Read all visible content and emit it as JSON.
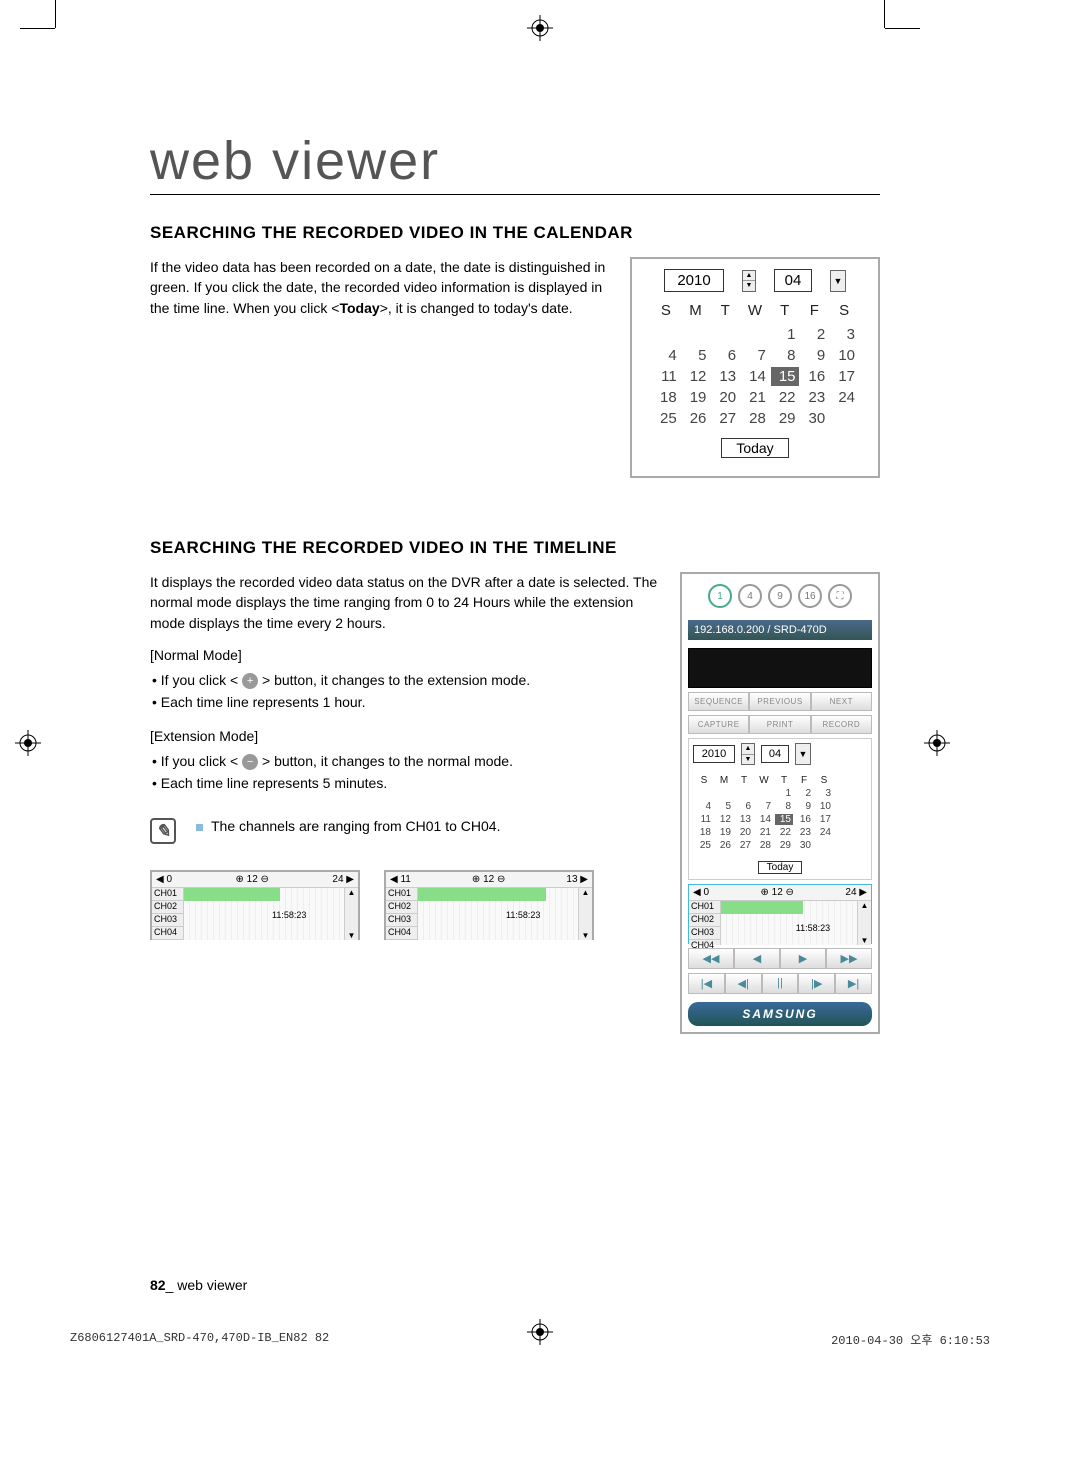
{
  "page_title": "web viewer",
  "section1": {
    "heading": "SEARCHING THE RECORDED VIDEO IN THE CALENDAR",
    "para_prefix": "If the video data has been recorded on a date, the date is distinguished in green. If you click the date, the recorded video information is displayed in the time line. When you click <",
    "para_bold": "Today",
    "para_suffix": ">, it is changed to today's date."
  },
  "calendar": {
    "year": "2010",
    "month": "04",
    "days_header": [
      "S",
      "M",
      "T",
      "W",
      "T",
      "F",
      "S"
    ],
    "weeks": [
      [
        "",
        "",
        "",
        "",
        "1",
        "2",
        "3"
      ],
      [
        "4",
        "5",
        "6",
        "7",
        "8",
        "9",
        "10"
      ],
      [
        "11",
        "12",
        "13",
        "14",
        "15",
        "16",
        "17"
      ],
      [
        "18",
        "19",
        "20",
        "21",
        "22",
        "23",
        "24"
      ],
      [
        "25",
        "26",
        "27",
        "28",
        "29",
        "30",
        ""
      ]
    ],
    "selected_day": "15",
    "today_label": "Today"
  },
  "section2": {
    "heading": "SEARCHING THE RECORDED VIDEO IN THE TIMELINE",
    "para": "It displays the recorded video data status on the DVR after a date is selected. The normal mode displays the time ranging from 0 to 24 Hours while the extension mode displays the time every 2 hours.",
    "normal_label": "[Normal Mode]",
    "normal_b1_pre": "If you click < ",
    "normal_b1_post": " > button, it changes to the extension mode.",
    "normal_b2": "Each time line represents 1 hour.",
    "ext_label": "[Extension Mode]",
    "ext_b1_pre": "If you click < ",
    "ext_b1_post": " > button, it changes to the normal mode.",
    "ext_b2": "Each time line represents 5 minutes.",
    "note": "The channels are ranging from CH01 to CH04."
  },
  "timeline": {
    "head_left_a": "0",
    "head_mid": "12",
    "head_right_a": "24",
    "head_left_b": "11",
    "head_right_b": "13",
    "channels": [
      "CH01",
      "CH02",
      "CH03",
      "CH04"
    ],
    "timestamp": "11:58:23"
  },
  "sidebar": {
    "view_opts": [
      "1",
      "4",
      "9",
      "16"
    ],
    "ip": "192.168.0.200",
    "model": "/ SRD-470D",
    "row1": [
      "SEQUENCE",
      "PREVIOUS",
      "NEXT"
    ],
    "row2": [
      "CAPTURE",
      "PRINT",
      "RECORD"
    ],
    "brand": "SAMSUNG",
    "playback1": [
      "◀◀",
      "◀",
      "▶",
      "▶▶"
    ],
    "playback2": [
      "|◀",
      "◀|",
      "||",
      "|▶",
      "▶|"
    ]
  },
  "footer": {
    "num": "82",
    "sep": "_ ",
    "label": "web viewer"
  },
  "print_footer": {
    "left": "Z6806127401A_SRD-470,470D-IB_EN82   82",
    "right": "2010-04-30   오후 6:10:53"
  }
}
